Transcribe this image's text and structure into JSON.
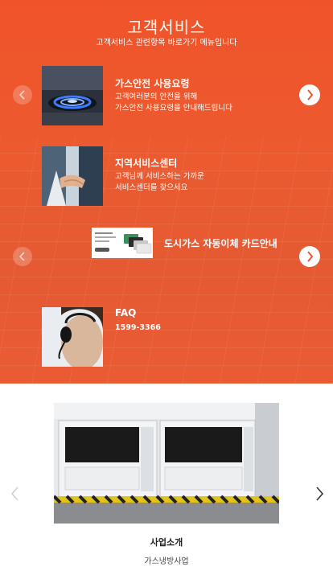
{
  "service": {
    "title": "고객서비스",
    "subtitle": "고객서비스 관련항목 바로가기 메뉴입니다",
    "items": [
      {
        "title": "가스안전 사용요령",
        "desc": "고객여러분의 안전을 위해\n가스안전 사용요령을 안내해드립니다",
        "image": "gas-burner-photo"
      },
      {
        "title": "지역서비스센터",
        "desc": "고객님께 서비스하는 가까운\n서비스센터를 찾으세요",
        "image": "handshake-photo"
      },
      {
        "title": "도시가스 자동이체 카드안내",
        "image": "credit-cards-photo"
      },
      {
        "title": "FAQ",
        "desc": "1599-3366",
        "image": "headset-operator-photo"
      }
    ]
  },
  "business": {
    "title": "사업소개",
    "subtitle": "가스냉방사업",
    "image": "gas-cooling-units-photo"
  },
  "colors": {
    "brand": "#ec5a2f",
    "text_light": "#ffffff"
  }
}
